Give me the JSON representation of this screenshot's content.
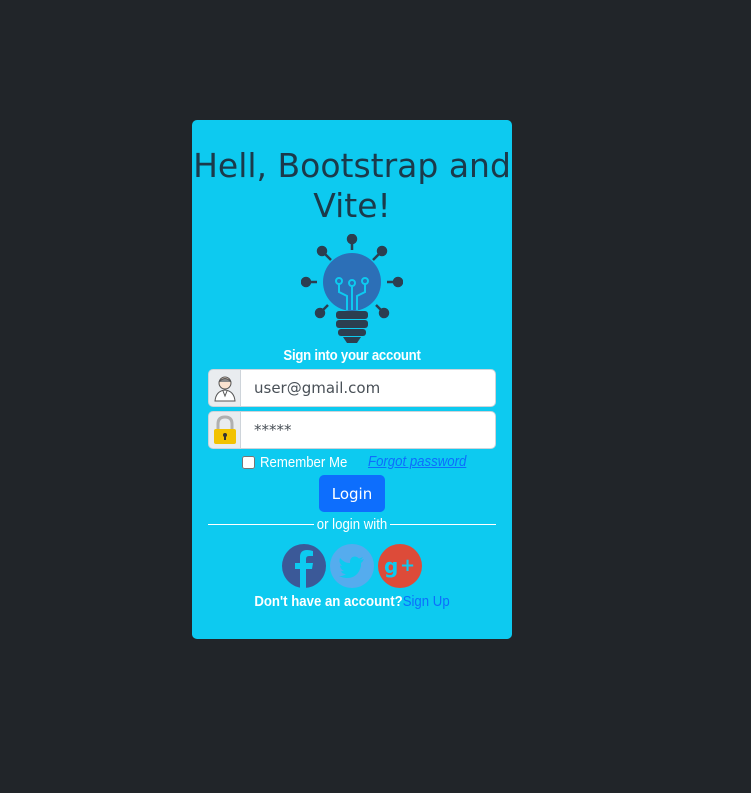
{
  "card": {
    "title": "Hell, Bootstrap and Vite!",
    "subtitle": "Sign into your account",
    "logo_icon": "lightbulb-circuit-icon"
  },
  "form": {
    "email": {
      "icon": "user-avatar-icon",
      "value": "user@gmail.com",
      "placeholder": ""
    },
    "password": {
      "icon": "padlock-icon",
      "value": "*****",
      "placeholder": ""
    },
    "remember_label": "Remember Me",
    "remember_checked": false,
    "forgot_label": "Forgot password",
    "login_label": "Login"
  },
  "social": {
    "divider_text": "or login with",
    "providers": [
      {
        "name": "facebook",
        "icon": "facebook-icon",
        "color": "#3b5998"
      },
      {
        "name": "twitter",
        "icon": "twitter-icon",
        "color": "#55acee"
      },
      {
        "name": "google-plus",
        "icon": "google-plus-icon",
        "color": "#dd4b39"
      }
    ]
  },
  "signup": {
    "question": "Don't have an account?",
    "link_label": "Sign Up"
  },
  "colors": {
    "page_bg": "#212529",
    "card_bg": "#0dcaf0",
    "primary": "#0d6efd",
    "title_text": "#1b3a4b"
  }
}
